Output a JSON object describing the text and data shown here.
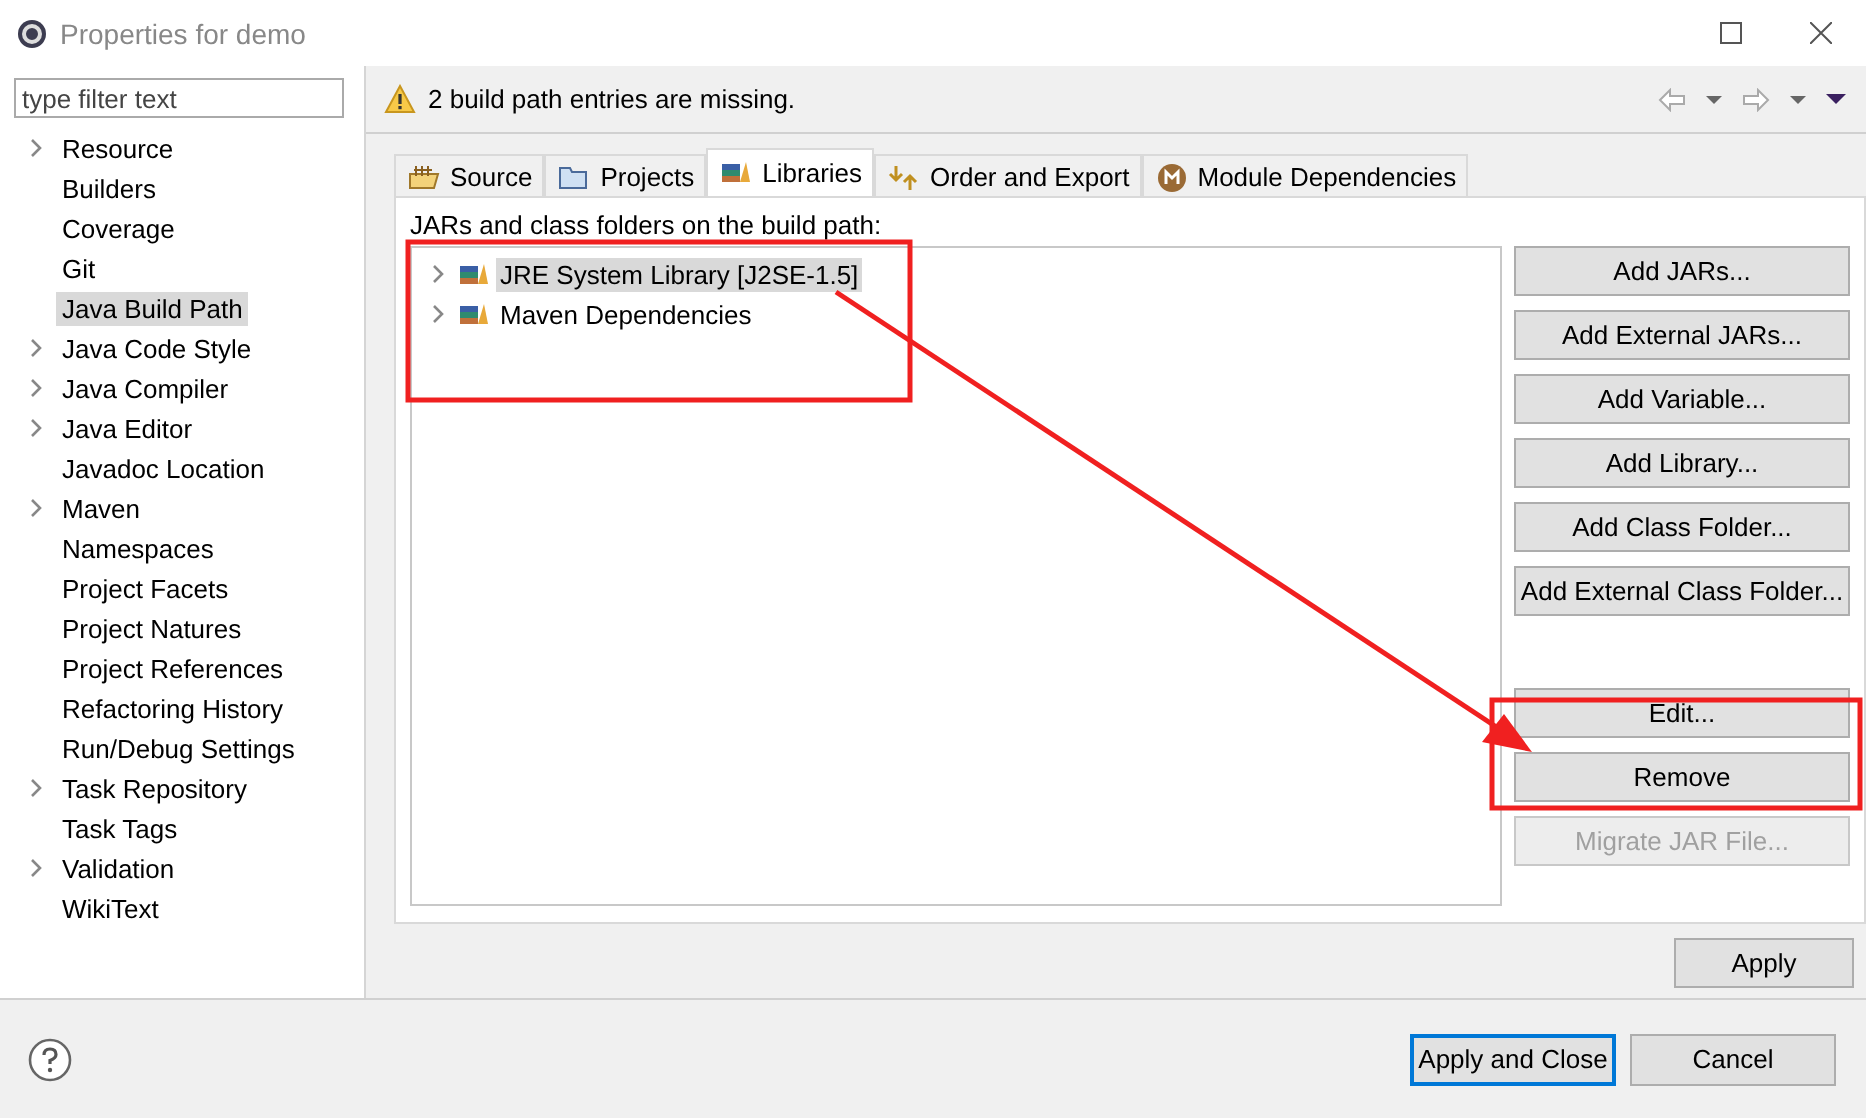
{
  "window": {
    "title": "Properties for demo"
  },
  "sidebar": {
    "filter": {
      "placeholder": "type filter text"
    },
    "items": [
      {
        "label": "Resource",
        "expandable": true,
        "selected": false
      },
      {
        "label": "Builders",
        "expandable": false,
        "selected": false
      },
      {
        "label": "Coverage",
        "expandable": false,
        "selected": false
      },
      {
        "label": "Git",
        "expandable": false,
        "selected": false
      },
      {
        "label": "Java Build Path",
        "expandable": false,
        "selected": true
      },
      {
        "label": "Java Code Style",
        "expandable": true,
        "selected": false
      },
      {
        "label": "Java Compiler",
        "expandable": true,
        "selected": false
      },
      {
        "label": "Java Editor",
        "expandable": true,
        "selected": false
      },
      {
        "label": "Javadoc Location",
        "expandable": false,
        "selected": false
      },
      {
        "label": "Maven",
        "expandable": true,
        "selected": false
      },
      {
        "label": "Namespaces",
        "expandable": false,
        "selected": false
      },
      {
        "label": "Project Facets",
        "expandable": false,
        "selected": false
      },
      {
        "label": "Project Natures",
        "expandable": false,
        "selected": false
      },
      {
        "label": "Project References",
        "expandable": false,
        "selected": false
      },
      {
        "label": "Refactoring History",
        "expandable": false,
        "selected": false
      },
      {
        "label": "Run/Debug Settings",
        "expandable": false,
        "selected": false
      },
      {
        "label": "Task Repository",
        "expandable": true,
        "selected": false
      },
      {
        "label": "Task Tags",
        "expandable": false,
        "selected": false
      },
      {
        "label": "Validation",
        "expandable": true,
        "selected": false
      },
      {
        "label": "WikiText",
        "expandable": false,
        "selected": false
      }
    ]
  },
  "message": {
    "kind": "warning",
    "text": "2 build path entries are missing."
  },
  "tabs": [
    {
      "label": "Source",
      "selected": false
    },
    {
      "label": "Projects",
      "selected": false
    },
    {
      "label": "Libraries",
      "selected": true
    },
    {
      "label": "Order and Export",
      "selected": false
    },
    {
      "label": "Module Dependencies",
      "selected": false
    }
  ],
  "libraries": {
    "caption": "JARs and class folders on the build path:",
    "entries": [
      {
        "label": "JRE System Library [J2SE-1.5]",
        "selected": true,
        "expanded": false
      },
      {
        "label": "Maven Dependencies",
        "selected": false,
        "expanded": false
      }
    ]
  },
  "buttons": [
    {
      "label": "Add JARs...",
      "disabled": false
    },
    {
      "label": "Add External JARs...",
      "disabled": false
    },
    {
      "label": "Add Variable...",
      "disabled": false
    },
    {
      "label": "Add Library...",
      "disabled": false
    },
    {
      "label": "Add Class Folder...",
      "disabled": false
    },
    {
      "label": "Add External Class Folder...",
      "disabled": false
    }
  ],
  "entry_buttons": [
    {
      "label": "Edit...",
      "disabled": false
    },
    {
      "label": "Remove",
      "disabled": false
    },
    {
      "label": "Migrate JAR File...",
      "disabled": true
    }
  ],
  "apply": {
    "label": "Apply"
  },
  "footer": {
    "buttons": [
      {
        "label": "Apply and Close",
        "default": true
      },
      {
        "label": "Cancel",
        "default": false
      }
    ]
  },
  "annotations": [
    {
      "kind": "box"
    },
    {
      "kind": "box"
    },
    {
      "kind": "arrow"
    }
  ]
}
